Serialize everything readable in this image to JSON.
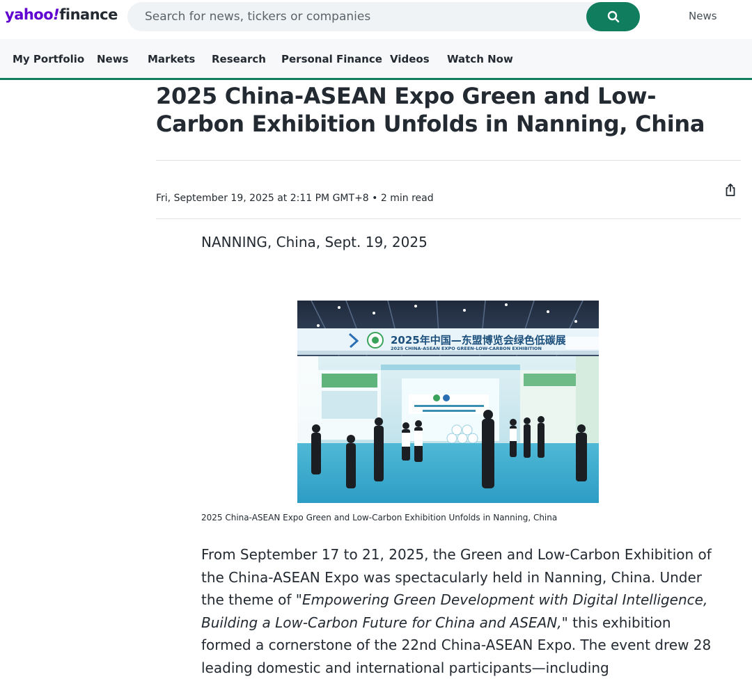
{
  "header": {
    "logo_yahoo": "yahoo",
    "logo_bang": "!",
    "logo_finance": "finance",
    "search_placeholder": "Search for news, tickers or companies",
    "top_news": "News"
  },
  "nav": {
    "items": [
      "My Portfolio",
      "News",
      "Markets",
      "Research",
      "Personal Finance",
      "Videos",
      "Watch Now"
    ]
  },
  "article": {
    "headline": "2025 China-ASEAN Expo Green and Low-Carbon Exhibition Unfolds in Nanning, China",
    "meta": "Fri, September 19, 2025 at 2:11 PM GMT+8 • 2 min read",
    "dateline": "NANNING, China, Sept. 19, 2025",
    "image_sign_cn": "2025年中国—东盟博览会绿色低碳展",
    "image_sign_en": "2025 CHINA-ASEAN EXPO GREEN-LOW-CARBON EXHIBITION",
    "caption": "2025 China-ASEAN Expo Green and Low-Carbon Exhibition Unfolds in Nanning, China",
    "p1_a": "From September 17 to 21, 2025, the Green and Low-Carbon Exhibition of the China-ASEAN Expo was spectacularly held in Nanning, China. Under the theme of ",
    "p1_em": "\"Empowering Green Development with Digital Intelligence, Building a Low-Carbon Future for China and ASEAN,\"",
    "p1_b": " this exhibition formed a cornerstone of the 22nd China-ASEAN Expo. The event drew 28 leading domestic and international participants—including"
  },
  "colors": {
    "brand_purple": "#6001d2",
    "accent_green": "#0f7d5e",
    "text": "#232a31"
  }
}
